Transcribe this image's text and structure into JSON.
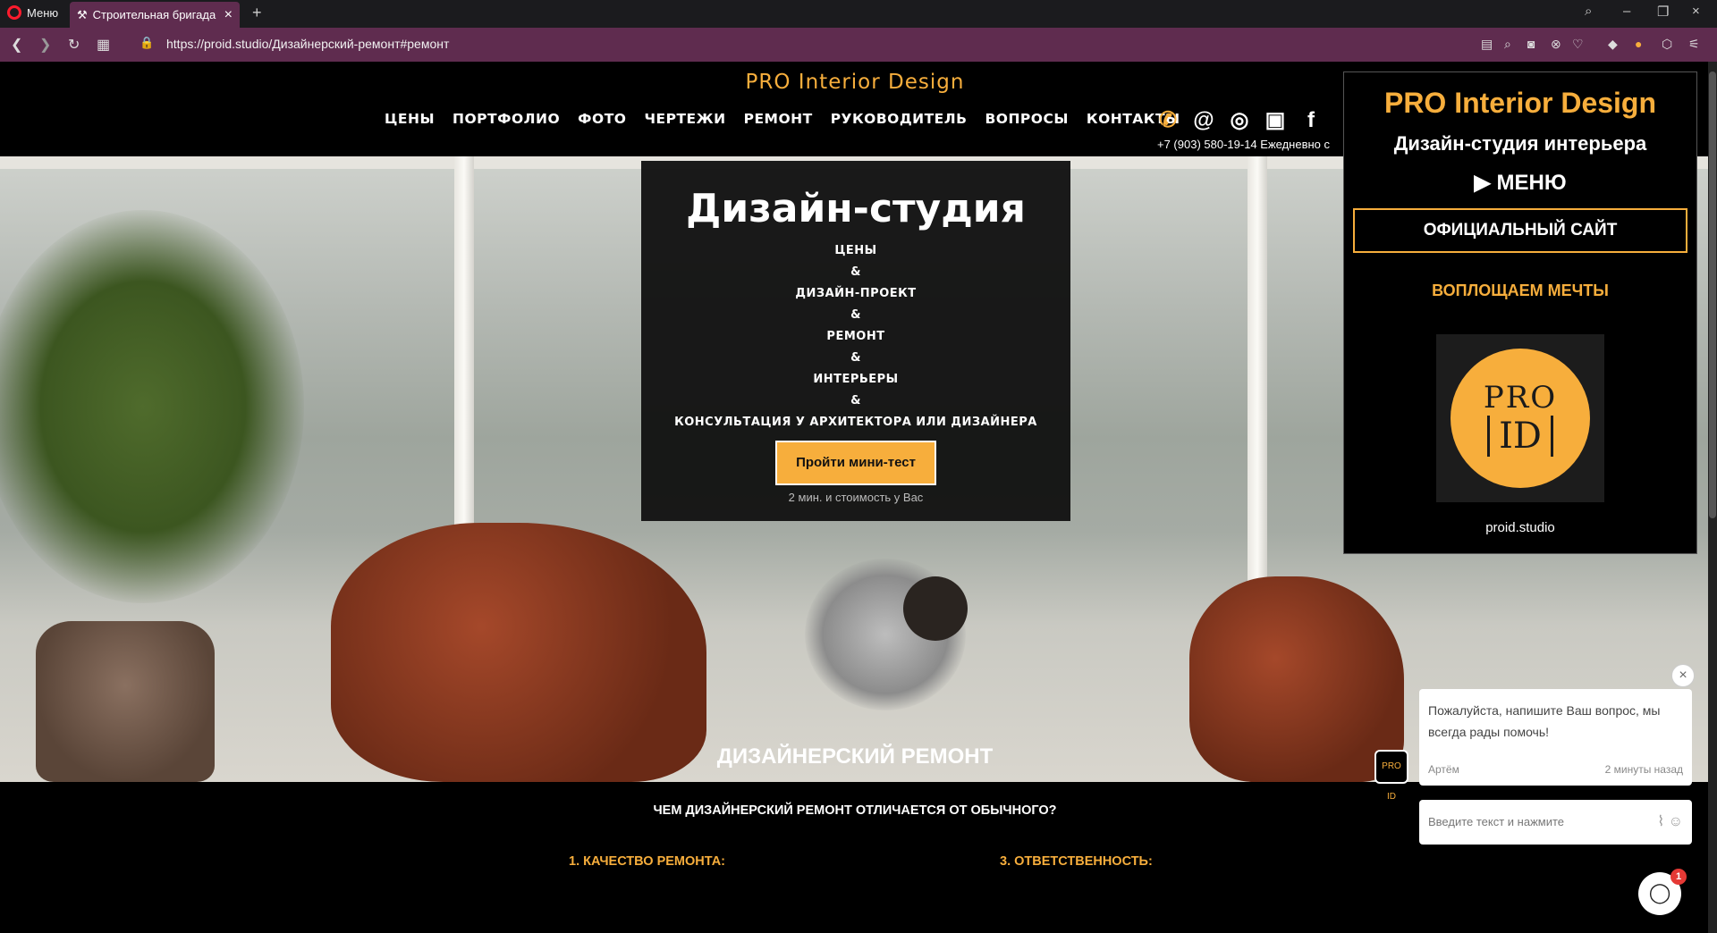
{
  "browser": {
    "menu_label": "Меню",
    "tab_title": "Строительная бригада сп",
    "url": "https://proid.studio/Дизайнерский-ремонт#ремонт"
  },
  "site": {
    "logo": "PRO Interior Design",
    "nav": [
      "ЦЕНЫ",
      "ПОРТФОЛИО",
      "ФОТО",
      "ЧЕРТЕЖИ",
      "РЕМОНТ",
      "РУКОВОДИТЕЛЬ",
      "ВОПРОСЫ",
      "КОНТАКТЫ"
    ],
    "phone_line": "+7 (903) 580-19-14 Ежедневно с",
    "accent_color": "#f7ae3c"
  },
  "hero": {
    "title": "Дизайн-студия",
    "lines": [
      "ЦЕНЫ",
      "&",
      "ДИЗАЙН-ПРОЕКТ",
      "&",
      "РЕМОНТ",
      "&",
      "ИНТЕРЬЕРЫ",
      "&",
      "КОНСУЛЬТАЦИЯ У АРХИТЕКТОРА ИЛИ ДИЗАЙНЕРА"
    ],
    "button": "Пройти мини-тест",
    "button_sub": "2 мин. и стоимость у Вас"
  },
  "section": {
    "title": "ДИЗАЙНЕРСКИЙ РЕМОНТ",
    "subtitle": "ЧЕМ ДИЗАЙНЕРСКИЙ РЕМОНТ ОТЛИЧАЕТСЯ ОТ ОБЫЧНОГО?",
    "col1": "1. КАЧЕСТВО РЕМОНТА:",
    "col3": "3. ОТВЕТСТВЕННОСТЬ:"
  },
  "popup": {
    "brand": "PRO Interior Design",
    "subtitle": "Дизайн-студия интерьера",
    "menu": "МЕНЮ",
    "official_button": "ОФИЦИАЛЬНЫЙ САЙТ",
    "dreams": "ВОПЛОЩАЕМ МЕЧТЫ",
    "logo_top": "PRO",
    "logo_bottom": "ID",
    "caption": "proid.studio"
  },
  "chat": {
    "message": "Пожалуйста, напишите Ваш вопрос, мы всегда рады помочь!",
    "author": "Артём",
    "time": "2 минуты назад",
    "input_placeholder": "Введите текст и нажмите",
    "badge_count": "1"
  }
}
